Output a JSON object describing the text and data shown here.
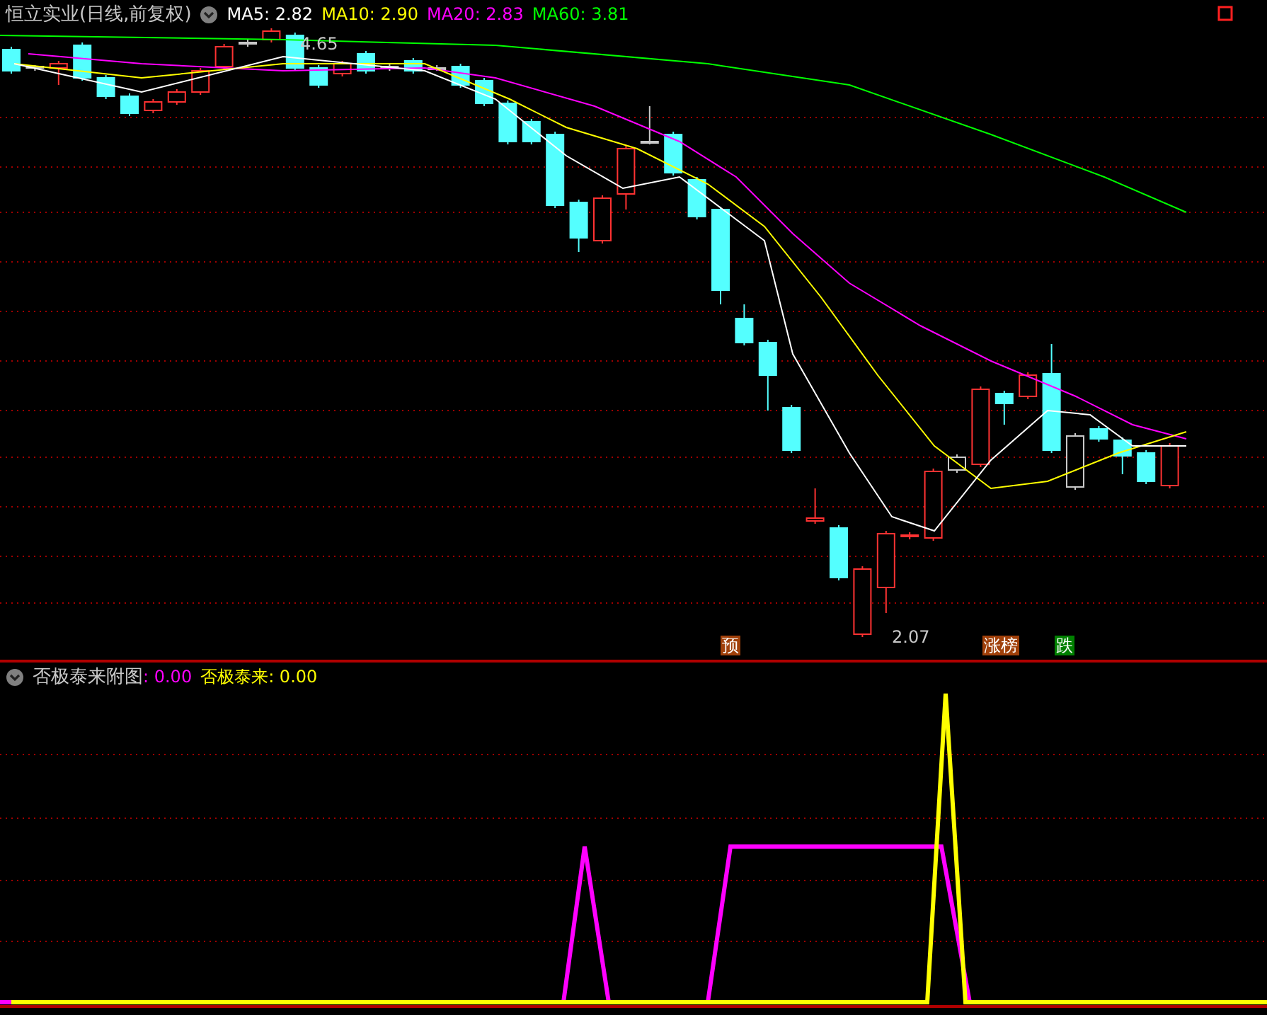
{
  "main_panel": {
    "title": "恒立实业(日线,前复权)",
    "moving_averages": [
      {
        "text": "MA5: 2.82",
        "color": "#ffffff"
      },
      {
        "text": "MA10: 2.90",
        "color": "#ffff00"
      },
      {
        "text": "MA20: 2.83",
        "color": "#ff00ff"
      },
      {
        "text": "MA60: 3.81",
        "color": "#00ff00"
      }
    ],
    "high_label": "4.65",
    "low_label": "2.07",
    "signals": [
      {
        "text": "预",
        "color": "#a0400a"
      },
      {
        "text": "涨榜",
        "color": "#a0400a"
      },
      {
        "text": "跌",
        "color": "#008000"
      }
    ]
  },
  "indicator_panel": {
    "title": "否极泰来附图",
    "readings": [
      {
        "text": ": 0.00",
        "color": "#ff00ff"
      },
      {
        "text": "否极泰来: 0.00",
        "color": "#ffff00"
      }
    ]
  }
}
